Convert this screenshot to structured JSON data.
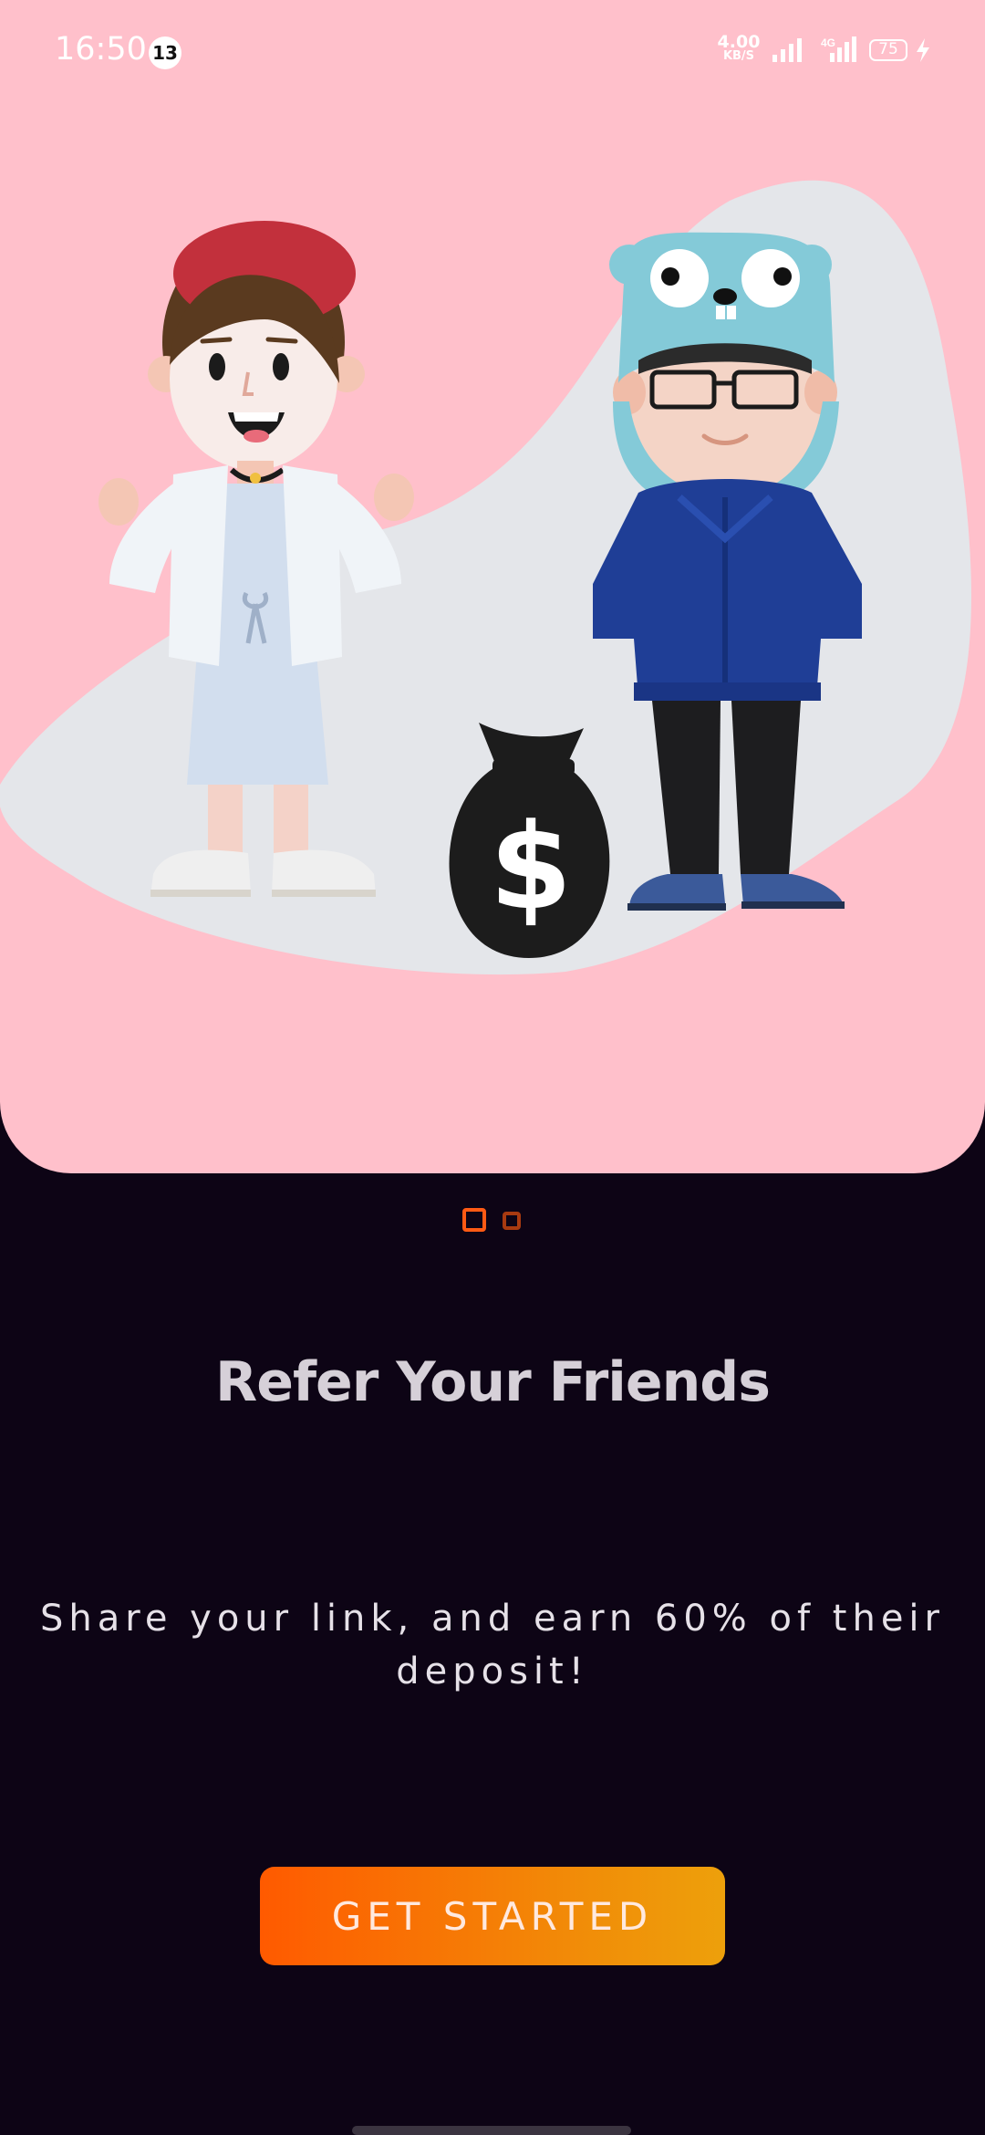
{
  "status_bar": {
    "time": "16:50",
    "notification_count": "13",
    "net_speed_value": "4.00",
    "net_speed_unit": "KB/S",
    "network_type": "4G",
    "battery_level": "75"
  },
  "onboarding": {
    "title": "Refer Your Friends",
    "subtitle": "Share your link, and earn 60% of their deposit!",
    "cta_label": "GET STARTED",
    "page_count": 2,
    "current_page": 1
  },
  "illustration": {
    "icons": [
      "girl-character-icon",
      "boy-gopher-hat-character-icon",
      "money-bag-icon"
    ]
  },
  "colors": {
    "hero_background": "#ffc0cb",
    "screen_background": "#0d0415",
    "accent": "#ff5a14",
    "cta_gradient_start": "#ff5a00",
    "cta_gradient_end": "#eda00b"
  }
}
